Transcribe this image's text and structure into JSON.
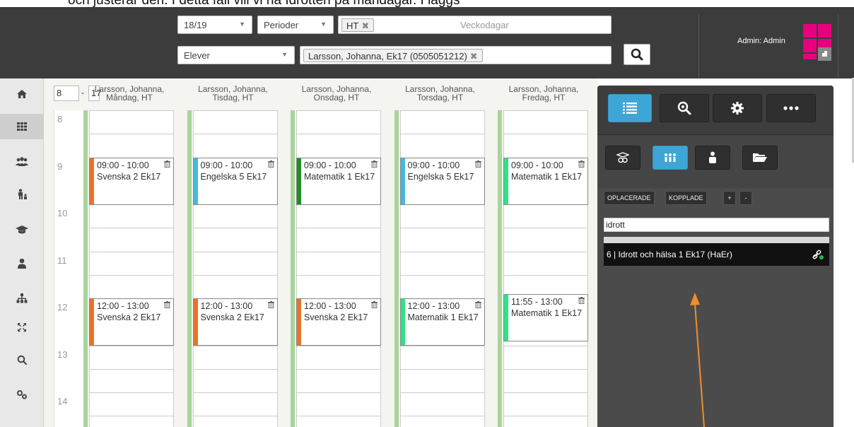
{
  "caption": "och justerar den. I detta fall vill vi ha Idrotten på måndagar. I läggs",
  "header": {
    "year": {
      "value": "18/19"
    },
    "periods": {
      "value": "Perioder"
    },
    "period_chip": "HT",
    "weekdays_placeholder": "Veckodagar",
    "type": {
      "value": "Elever"
    },
    "student_chip": "Larsson, Johanna, Ek17 (0505051212)",
    "admin_label": "Admin: Admin"
  },
  "sidebar": {
    "items": [
      {
        "name": "home",
        "icon": "home-icon"
      },
      {
        "name": "schedule",
        "icon": "grid-icon",
        "active": true
      },
      {
        "name": "groups",
        "icon": "users-icon"
      },
      {
        "name": "hierarchy",
        "icon": "org-icon"
      },
      {
        "name": "courses",
        "icon": "graduation-cap-icon"
      },
      {
        "name": "person",
        "icon": "user-icon"
      },
      {
        "name": "structure",
        "icon": "sitemap-icon"
      },
      {
        "name": "expand",
        "icon": "expand-icon"
      },
      {
        "name": "search",
        "icon": "search-icon"
      },
      {
        "name": "settings",
        "icon": "cogs-icon"
      }
    ]
  },
  "schedule": {
    "range_from": "8",
    "range_to": "17",
    "hours": [
      "8",
      "9",
      "10",
      "11",
      "12",
      "13",
      "14"
    ],
    "days": [
      {
        "line1": "Larsson, Johanna,",
        "line2": "Måndag, HT",
        "lessons": [
          {
            "time": "09:00 - 10:00",
            "course": "Svenska 2 Ek17",
            "color": "#e8742a",
            "start": 9
          },
          {
            "time": "12:00 - 13:00",
            "course": "Svenska 2 Ek17",
            "color": "#e8742a",
            "start": 12
          }
        ]
      },
      {
        "line1": "Larsson, Johanna,",
        "line2": "Tisdag, HT",
        "lessons": [
          {
            "time": "09:00 - 10:00",
            "course": "Engelska 5 Ek17",
            "color": "#44b8e0",
            "start": 9
          },
          {
            "time": "12:00 - 13:00",
            "course": "Svenska 2 Ek17",
            "color": "#e8742a",
            "start": 12
          }
        ]
      },
      {
        "line1": "Larsson, Johanna,",
        "line2": "Onsdag, HT",
        "lessons": [
          {
            "time": "09:00 - 10:00",
            "course": "Matematik 1 Ek17",
            "color": "#1d8f2a",
            "start": 9
          },
          {
            "time": "12:00 - 13:00",
            "course": "Svenska 2 Ek17",
            "color": "#e8742a",
            "start": 12
          }
        ]
      },
      {
        "line1": "Larsson, Johanna,",
        "line2": "Torsdag, HT",
        "lessons": [
          {
            "time": "09:00 - 10:00",
            "course": "Engelska 5 Ek17",
            "color": "#44b8e0",
            "start": 9
          },
          {
            "time": "12:00 - 13:00",
            "course": "Matematik 1 Ek17",
            "color": "#2fe28a",
            "start": 12
          }
        ]
      },
      {
        "line1": "Larsson, Johanna,",
        "line2": "Fredag, HT",
        "lessons": [
          {
            "time": "09:00 - 10:00",
            "course": "Matematik 1 Ek17",
            "color": "#2fe28a",
            "start": 9
          },
          {
            "time": "11:55 - 13:00",
            "course": "Matematik 1 Ek17",
            "color": "#2fe28a",
            "start": 11.9167
          }
        ]
      }
    ]
  },
  "panel": {
    "btn_unplaced": "OPLACERADE",
    "btn_linked": "KOPPLADE",
    "btn_plus": "+",
    "btn_minus": "-",
    "filter_value": "idrott",
    "result": "6 | Idrott och hälsa 1 Ek17 (HaEr)"
  },
  "colors": {
    "accent": "#3ea6d6",
    "brand": "#e6007e",
    "annotation_arrow": "#f28c2c"
  }
}
